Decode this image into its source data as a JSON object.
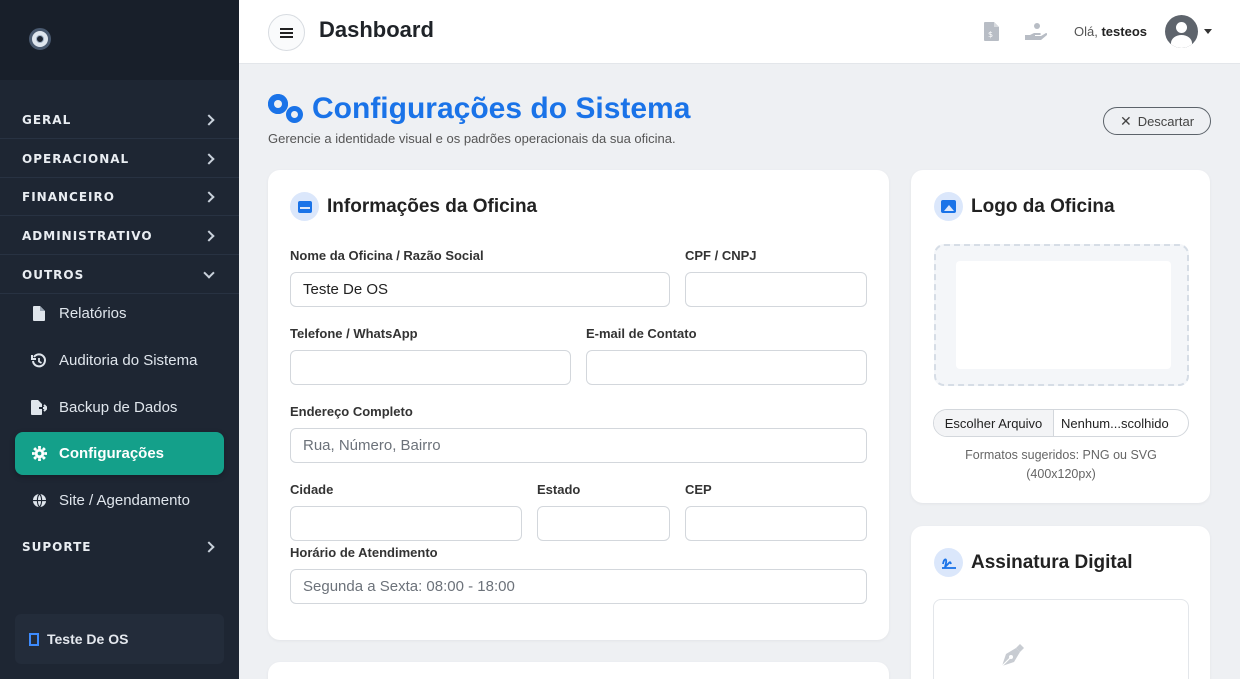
{
  "sidebar": {
    "sections": [
      "GERAL",
      "OPERACIONAL",
      "FINANCEIRO",
      "ADMINISTRATIVO",
      "OUTROS",
      "SUPORTE"
    ],
    "submenu": [
      {
        "label": "Relatórios",
        "icon": "file-icon"
      },
      {
        "label": "Auditoria do Sistema",
        "icon": "history-icon"
      },
      {
        "label": "Backup de Dados",
        "icon": "file-export-icon"
      },
      {
        "label": "Configurações",
        "icon": "gear-icon",
        "active": true
      },
      {
        "label": "Site / Agendamento",
        "icon": "globe-icon"
      }
    ],
    "footer": "Teste De OS"
  },
  "topbar": {
    "title": "Dashboard",
    "greeting": "Olá,",
    "username": "testeos"
  },
  "page": {
    "title": "Configurações do Sistema",
    "subtitle": "Gerencie a identidade visual e os padrões operacionais da sua oficina.",
    "discard_label": "Descartar"
  },
  "info_card": {
    "title": "Informações da Oficina",
    "fields": {
      "nome": {
        "label": "Nome da Oficina / Razão Social",
        "value": "Teste De OS",
        "placeholder": ""
      },
      "cpf": {
        "label": "CPF / CNPJ",
        "value": "",
        "placeholder": ""
      },
      "telefone": {
        "label": "Telefone / WhatsApp",
        "value": "",
        "placeholder": ""
      },
      "email": {
        "label": "E-mail de Contato",
        "value": "",
        "placeholder": ""
      },
      "endereco": {
        "label": "Endereço Completo",
        "value": "",
        "placeholder": "Rua, Número, Bairro"
      },
      "cidade": {
        "label": "Cidade",
        "value": "",
        "placeholder": ""
      },
      "estado": {
        "label": "Estado",
        "value": "",
        "placeholder": ""
      },
      "cep": {
        "label": "CEP",
        "value": "",
        "placeholder": ""
      },
      "horario": {
        "label": "Horário de Atendimento",
        "value": "",
        "placeholder": "Segunda a Sexta: 08:00 - 18:00"
      }
    }
  },
  "logo_card": {
    "title": "Logo da Oficina",
    "choose_label": "Escolher Arquivo",
    "file_name": "Nenhum...scolhido",
    "formats_line1": "Formatos sugeridos: PNG ou SVG",
    "formats_line2": "(400x120px)"
  },
  "signature_card": {
    "title": "Assinatura Digital"
  },
  "colors": {
    "sidebar_bg": "#1e2633",
    "active_item": "#14a08a",
    "accent": "#1a73e8"
  }
}
